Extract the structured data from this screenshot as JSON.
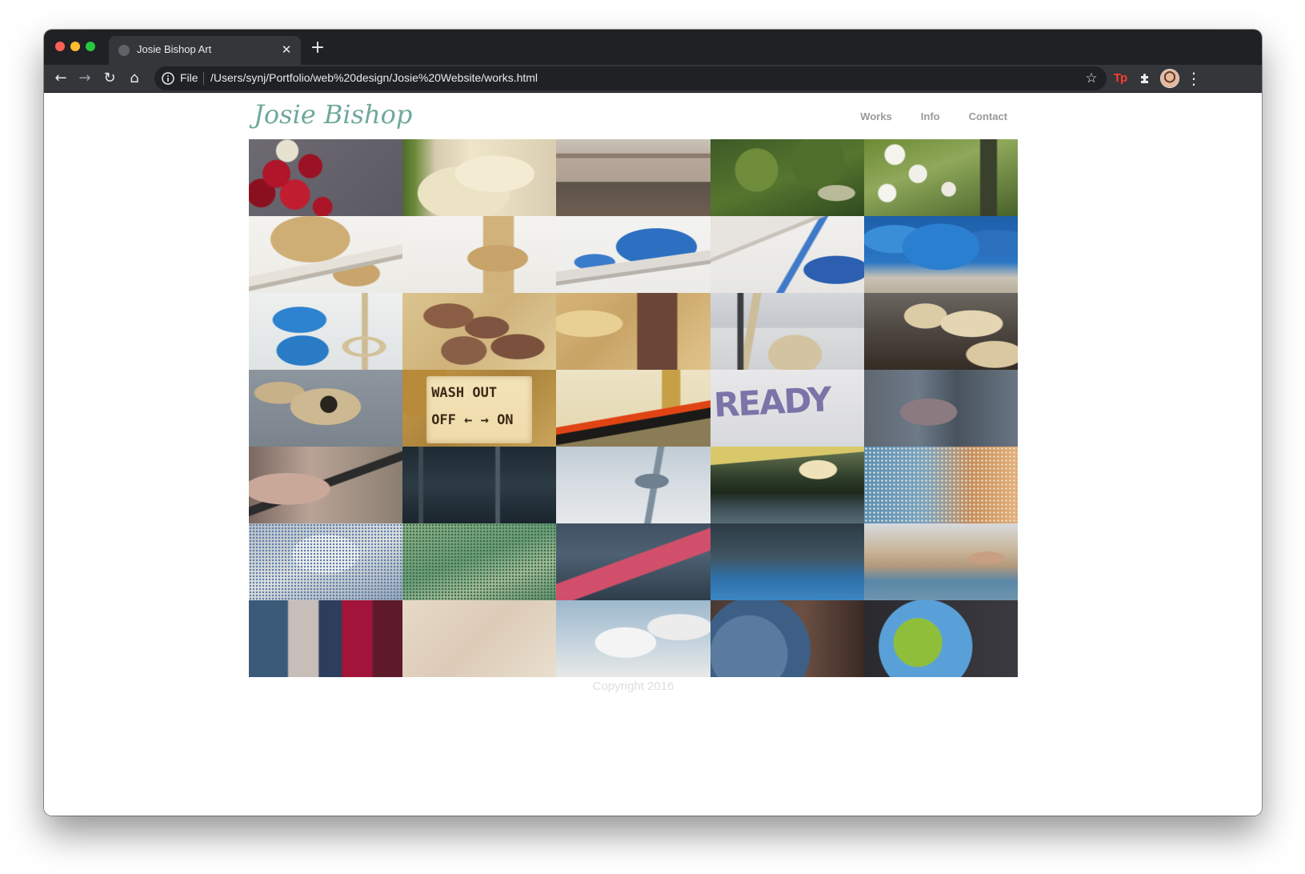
{
  "browser": {
    "tab_title": "Josie Bishop Art",
    "tab_close_glyph": "✕",
    "new_tab_glyph": "+",
    "site_info_label": "File",
    "url": "/Users/synj/Portfolio/web%20design/Josie%20Website/works.html",
    "ext_tp_label": "Tp",
    "icons": {
      "back": "←",
      "forward": "→",
      "reload": "↻",
      "home": "⌂",
      "star": "☆",
      "puzzle": "✱",
      "menu": "⋮"
    }
  },
  "site": {
    "logo": "Josie Bishop",
    "logo_color": "#6fa99b",
    "nav": [
      {
        "label": "Works"
      },
      {
        "label": "Info"
      },
      {
        "label": "Contact"
      }
    ],
    "copyright": "Copyright 2016"
  },
  "gallery": {
    "sign_line1": "WASH  OUT",
    "sign_line2": "OFF ← → ON",
    "graffiti_text": "READY",
    "thumbnails": [
      {
        "name": "red-roses"
      },
      {
        "name": "white-plaster-figure"
      },
      {
        "name": "building-with-railing"
      },
      {
        "name": "ivy-gravestone"
      },
      {
        "name": "white-blossom-cross"
      },
      {
        "name": "beige-rope-on-shelf"
      },
      {
        "name": "beige-rope-hanging"
      },
      {
        "name": "blue-rope-on-shelf"
      },
      {
        "name": "blue-rope-under-shelf"
      },
      {
        "name": "blue-rope-knot"
      },
      {
        "name": "blue-rope-and-noose"
      },
      {
        "name": "brown-braids-on-wood"
      },
      {
        "name": "brown-braid-on-osb"
      },
      {
        "name": "rope-on-post"
      },
      {
        "name": "braided-beige-rope"
      },
      {
        "name": "knotted-beige-rope"
      },
      {
        "name": "wash-out-sign"
      },
      {
        "name": "cracked-wall-graffiti"
      },
      {
        "name": "ready-graffiti"
      },
      {
        "name": "ghostly-face-overlay"
      },
      {
        "name": "face-closeup"
      },
      {
        "name": "dark-industrial"
      },
      {
        "name": "helicopter-silhouette"
      },
      {
        "name": "forest-lake-collage"
      },
      {
        "name": "halftone-building"
      },
      {
        "name": "halftone-light-silver"
      },
      {
        "name": "halftone-green"
      },
      {
        "name": "street-scene-red"
      },
      {
        "name": "pool-scene"
      },
      {
        "name": "palace-crowd"
      },
      {
        "name": "blue-red-abstract"
      },
      {
        "name": "pale-sand"
      },
      {
        "name": "cloudy-sky"
      },
      {
        "name": "earth-from-space"
      },
      {
        "name": "green-planet"
      }
    ]
  }
}
